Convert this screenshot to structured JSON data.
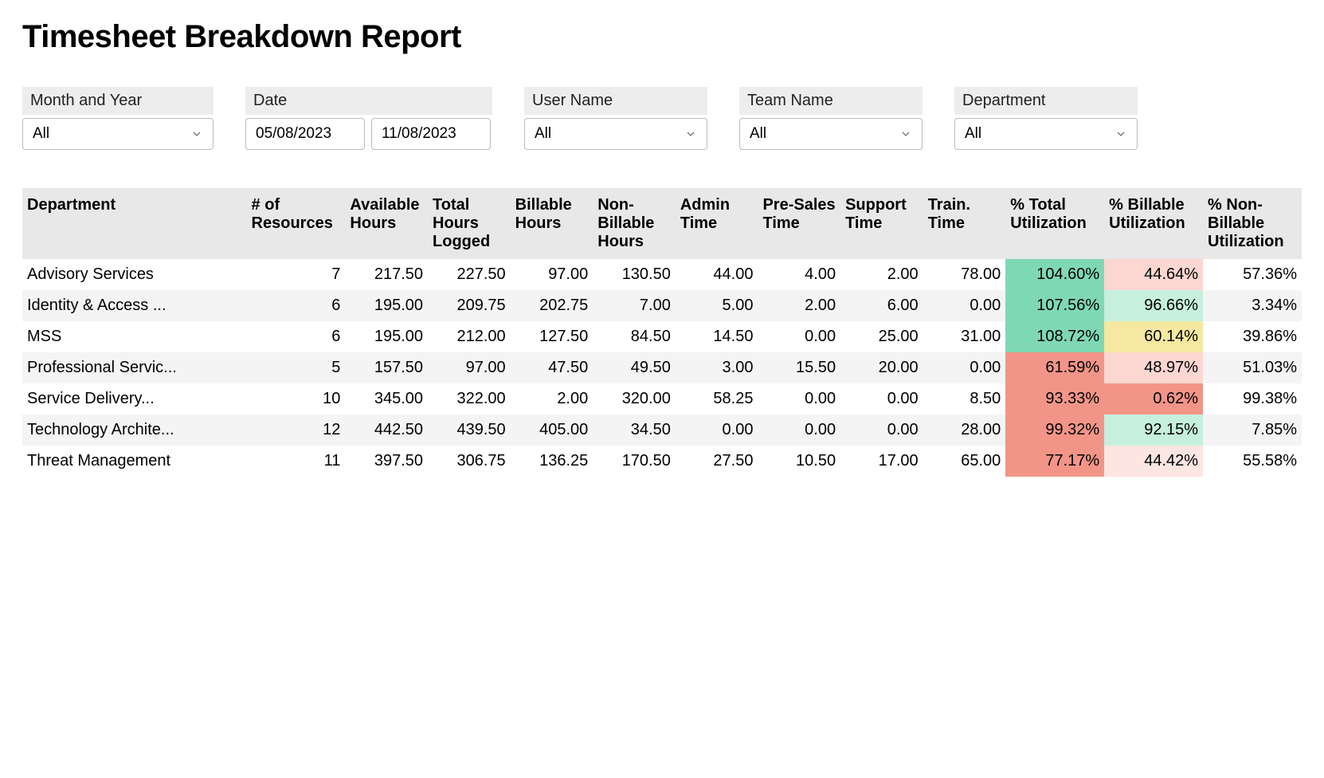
{
  "title": "Timesheet Breakdown Report",
  "filters": {
    "month_year": {
      "label": "Month and Year",
      "value": "All"
    },
    "date": {
      "label": "Date",
      "from": "05/08/2023",
      "to": "11/08/2023"
    },
    "user": {
      "label": "User Name",
      "value": "All"
    },
    "team": {
      "label": "Team Name",
      "value": "All"
    },
    "dept": {
      "label": "Department",
      "value": "All"
    }
  },
  "columns": [
    "Department",
    "# of Resources",
    "Available Hours",
    "Total Hours Logged",
    "Billable Hours",
    "Non-Billable Hours",
    "Admin Time",
    "Pre-Sales Time",
    "Support Time",
    "Train. Time",
    "% Total Utilization",
    "% Billable Utilization",
    "% Non-Billable Utilization"
  ],
  "rows": [
    {
      "dept": "Advisory Services",
      "res": "7",
      "avail": "217.50",
      "total": "227.50",
      "bill": "97.00",
      "nonbill": "130.50",
      "admin": "44.00",
      "presales": "4.00",
      "supp": "2.00",
      "train": "78.00",
      "ptotal": "104.60%",
      "pbill": "44.64%",
      "pnon": "57.36%",
      "pt_cls": "hl-green-d",
      "pb_cls": "hl-red-l"
    },
    {
      "dept": "Identity & Access ...",
      "res": "6",
      "avail": "195.00",
      "total": "209.75",
      "bill": "202.75",
      "nonbill": "7.00",
      "admin": "5.00",
      "presales": "2.00",
      "supp": "6.00",
      "train": "0.00",
      "ptotal": "107.56%",
      "pbill": "96.66%",
      "pnon": "3.34%",
      "pt_cls": "hl-green-d",
      "pb_cls": "hl-green-l"
    },
    {
      "dept": "MSS",
      "res": "6",
      "avail": "195.00",
      "total": "212.00",
      "bill": "127.50",
      "nonbill": "84.50",
      "admin": "14.50",
      "presales": "0.00",
      "supp": "25.00",
      "train": "31.00",
      "ptotal": "108.72%",
      "pbill": "60.14%",
      "pnon": "39.86%",
      "pt_cls": "hl-green-d",
      "pb_cls": "hl-yellow"
    },
    {
      "dept": "Professional Servic...",
      "res": "5",
      "avail": "157.50",
      "total": "97.00",
      "bill": "47.50",
      "nonbill": "49.50",
      "admin": "3.00",
      "presales": "15.50",
      "supp": "20.00",
      "train": "0.00",
      "ptotal": "61.59%",
      "pbill": "48.97%",
      "pnon": "51.03%",
      "pt_cls": "hl-red-d",
      "pb_cls": "hl-red-l"
    },
    {
      "dept": "Service Delivery...",
      "res": "10",
      "avail": "345.00",
      "total": "322.00",
      "bill": "2.00",
      "nonbill": "320.00",
      "admin": "58.25",
      "presales": "0.00",
      "supp": "0.00",
      "train": "8.50",
      "ptotal": "93.33%",
      "pbill": "0.62%",
      "pnon": "99.38%",
      "pt_cls": "hl-red-d",
      "pb_cls": "hl-red-d"
    },
    {
      "dept": "Technology Archite...",
      "res": "12",
      "avail": "442.50",
      "total": "439.50",
      "bill": "405.00",
      "nonbill": "34.50",
      "admin": "0.00",
      "presales": "0.00",
      "supp": "0.00",
      "train": "28.00",
      "ptotal": "99.32%",
      "pbill": "92.15%",
      "pnon": "7.85%",
      "pt_cls": "hl-red-d",
      "pb_cls": "hl-green-l"
    },
    {
      "dept": "Threat Management",
      "res": "11",
      "avail": "397.50",
      "total": "306.75",
      "bill": "136.25",
      "nonbill": "170.50",
      "admin": "27.50",
      "presales": "10.50",
      "supp": "17.00",
      "train": "65.00",
      "ptotal": "77.17%",
      "pbill": "44.42%",
      "pnon": "55.58%",
      "pt_cls": "hl-red-d",
      "pb_cls": "hl-red-xl"
    }
  ]
}
